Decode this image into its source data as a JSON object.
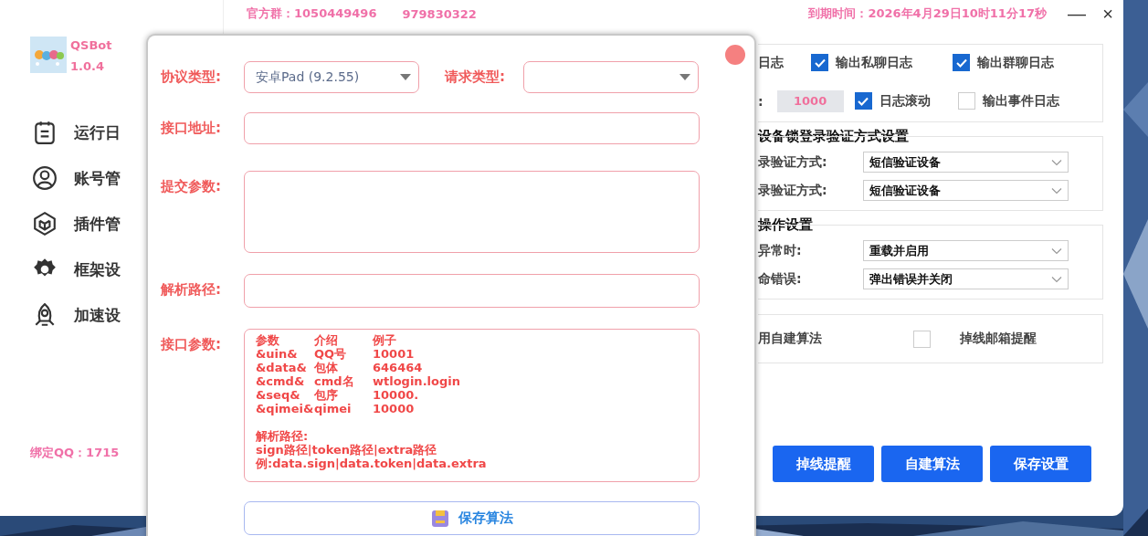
{
  "header": {
    "official_group": "官方群：1050449496",
    "group_2": "979830322",
    "expiry": "到期时间：2026年4月29日10时11分17秒",
    "minimize": "—",
    "close": "×"
  },
  "sidebar": {
    "app_name": "QSBot",
    "version": "1.0.4",
    "items": [
      {
        "label": "运行日"
      },
      {
        "label": "账号管"
      },
      {
        "label": "插件管"
      },
      {
        "label": "框架设"
      },
      {
        "label": "加速设"
      }
    ],
    "bound_qq": "绑定QQ：1715"
  },
  "settings": {
    "log_group": {
      "row_1": {
        "label_fragment": "日志",
        "options": [
          {
            "label": "输出私聊日志",
            "checked": true
          },
          {
            "label": "输出群聊日志",
            "checked": true
          }
        ]
      },
      "row_2": {
        "label_fragment": ":",
        "max_lines": {
          "value": "1000",
          "disabled": true
        },
        "options": [
          {
            "label": "日志滚动",
            "checked": true
          },
          {
            "label": "输出事件日志",
            "checked": false
          }
        ]
      }
    },
    "device_lock_group": {
      "title": "设备锁登录验证方式设置",
      "rows": [
        {
          "label": "录验证方式:",
          "value": "短信验证设备"
        },
        {
          "label": "录验证方式:",
          "value": "短信验证设备"
        }
      ]
    },
    "operation_group": {
      "title": "操作设置",
      "rows": [
        {
          "label": "异常时:",
          "value": "重载并启用"
        },
        {
          "label": "命错误:",
          "value": "弹出错误并关闭"
        }
      ]
    },
    "extra_group": {
      "custom_algorithm_label": "用自建算法",
      "email_alert": {
        "label": "掉线邮箱提醒",
        "checked": false
      }
    },
    "buttons": [
      "掉线提醒",
      "自建算法",
      "保存设置"
    ]
  },
  "dialog": {
    "protocol_label": "协议类型:",
    "protocol_value": "安卓Pad (9.2.55)",
    "request_label": "请求类型:",
    "api_url_label": "接口地址:",
    "submit_params_label": "提交参数:",
    "parse_path_label": "解析路径:",
    "api_params_label": "接口参数:",
    "param_table": {
      "columns": [
        "参数",
        "介绍",
        "例子"
      ],
      "rows": [
        [
          "&uin&",
          "QQ号",
          "10001"
        ],
        [
          "&data&",
          "包体",
          "646464"
        ],
        [
          "&cmd&",
          "cmd名",
          "wtlogin.login"
        ],
        [
          "&seq&",
          "包序",
          "10000."
        ],
        [
          "&qimei&",
          "qimei",
          "10000"
        ]
      ]
    },
    "parse_notes": [
      "解析路径:",
      "sign路径|token路径|extra路径",
      "例:data.sign|data.token|data.extra"
    ],
    "save_button": "保存算法"
  }
}
